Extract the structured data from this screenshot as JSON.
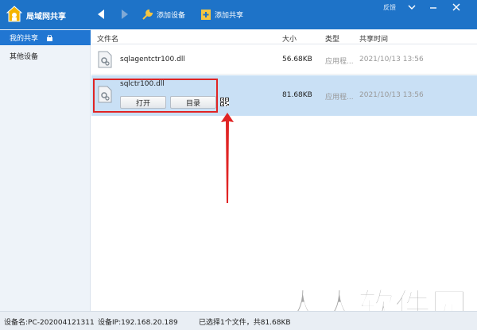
{
  "app": {
    "title": "局域网共享"
  },
  "toolbar": {
    "add_device": "添加设备",
    "add_share": "添加共享",
    "feedback": "反馈"
  },
  "sidebar": {
    "items": [
      {
        "label": "我的共享"
      },
      {
        "label": "其他设备"
      }
    ]
  },
  "columns": {
    "name": "文件名",
    "size": "大小",
    "type": "类型",
    "time": "共享时间"
  },
  "files": [
    {
      "name": "sqlagentctr100.dll",
      "size": "56.68KB",
      "type": "应用程...",
      "time": "2021/10/13 13:56"
    },
    {
      "name": "sqlctr100.dll",
      "size": "81.68KB",
      "type": "应用程...",
      "time": "2021/10/13 13:56",
      "actions": {
        "open": "打开",
        "dir": "目录"
      }
    }
  ],
  "status": {
    "device": "设备名:PC-202004121311",
    "ip": "设备IP:192.168.20.189",
    "selection": "已选择1个文件，共81.68KB"
  },
  "watermark": {
    "text": "人人软件园"
  },
  "colors": {
    "titlebar": "#1e73c8",
    "selected_row": "#c9e0f5",
    "annotation": "#e02424"
  }
}
